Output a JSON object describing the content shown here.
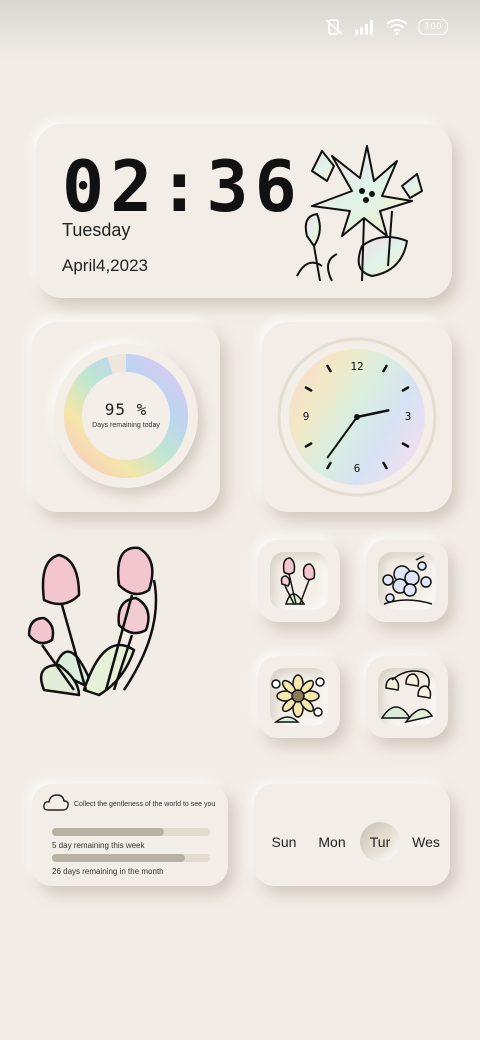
{
  "status": {
    "battery": "100"
  },
  "clock_widget": {
    "time": "02:36",
    "day": "Tuesday",
    "date": "April4,2023"
  },
  "progress_widget": {
    "percent_text": "95 %",
    "label": "Days remaining today",
    "progress": 0.95
  },
  "analog_clock": {
    "numerals": [
      "12",
      "3",
      "6",
      "9"
    ],
    "hour": 2,
    "minute": 36
  },
  "app_tiles": [
    {
      "name": "tulip-flowers"
    },
    {
      "name": "violet-flowers"
    },
    {
      "name": "sunflower-flowers"
    },
    {
      "name": "bellflower-flowers"
    }
  ],
  "info_widget": {
    "quote": "Collect the gentleness of the world to see you",
    "week_label": "5   day remaining this week",
    "month_label": "26 days remaining in the month",
    "week_fill": 0.71,
    "month_fill": 0.84
  },
  "weekday_widget": {
    "days": [
      "Sun",
      "Mon",
      "Tur",
      "Wes"
    ],
    "active": "Tur"
  }
}
